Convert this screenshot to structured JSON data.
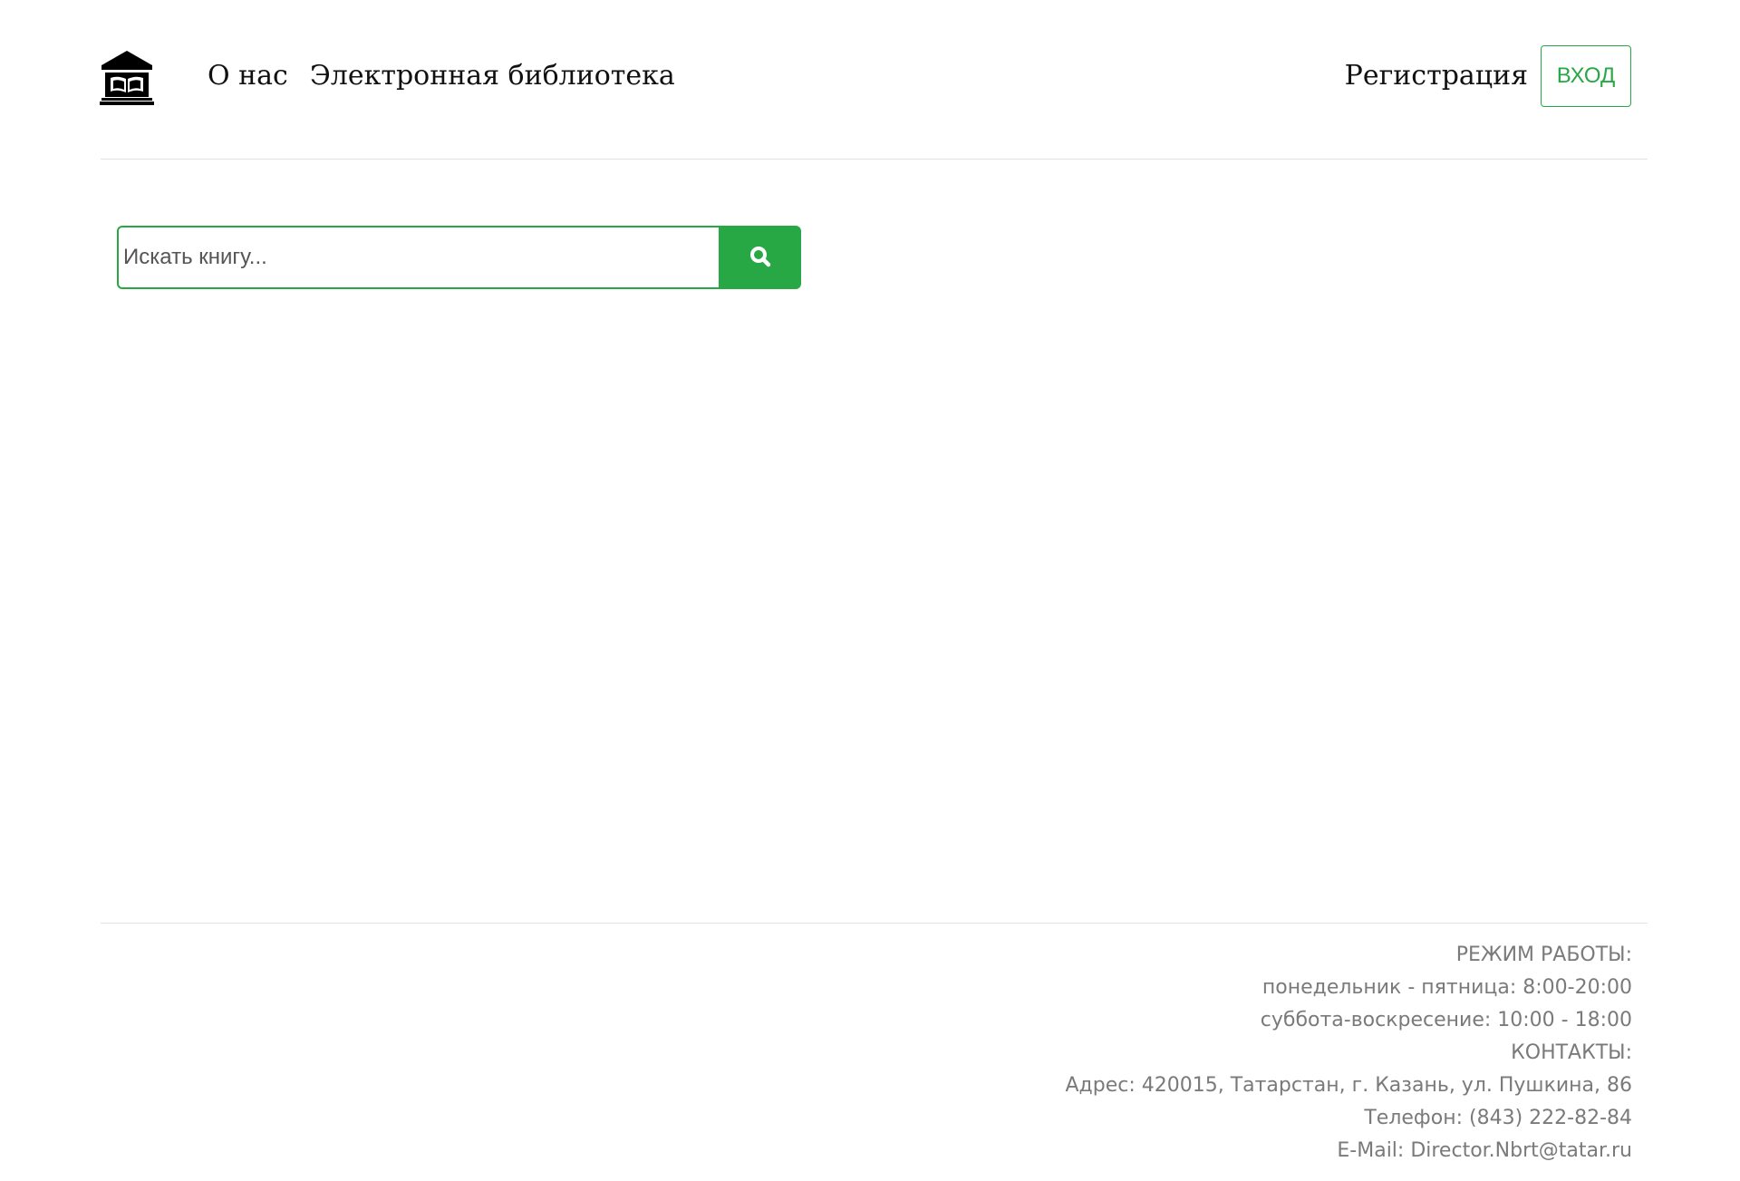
{
  "header": {
    "logo_icon": "library-icon",
    "nav": {
      "about": "О нас",
      "library": "Электронная библиотека"
    },
    "register": "Регистрация",
    "login": "ВХОД"
  },
  "search": {
    "placeholder": "Искать книгу...",
    "value": "",
    "button_icon": "search-icon"
  },
  "footer": {
    "hours_title": "РЕЖИМ РАБОТЫ:",
    "weekdays": "понедельник - пятница: 8:00-20:00",
    "weekend": "суббота-воскресение: 10:00 - 18:00",
    "contacts_title": "КОНТАКТЫ:",
    "address": "Адрес: 420015, Татарстан, г. Казань, ул. Пушкина, 86",
    "phone": "Телефон: (843) 222-82-84",
    "email": "E-Mail: Director.Nbrt@tatar.ru"
  },
  "colors": {
    "accent": "#28a745",
    "footer_text": "#7a7a7a",
    "divider": "#e2e2e2"
  }
}
